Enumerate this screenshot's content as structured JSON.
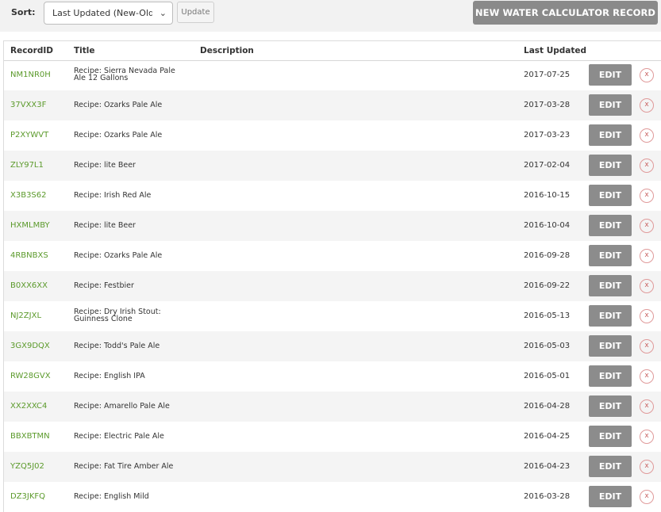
{
  "toolbar": {
    "sort_label": "Sort:",
    "sort_value": "Last Updated (New-Old)",
    "update_label": "Update",
    "new_record_label": "NEW WATER CALCULATOR RECORD"
  },
  "table": {
    "headers": {
      "record_id": "RecordID",
      "title": "Title",
      "description": "Description",
      "last_updated": "Last Updated"
    },
    "edit_label": "EDIT",
    "delete_label": "x",
    "rows": [
      {
        "id": "NM1NR0H",
        "title": "Recipe: Sierra Nevada Pale Ale 12 Gallons",
        "description": "",
        "updated": "2017-07-25"
      },
      {
        "id": "37VXX3F",
        "title": "Recipe: Ozarks Pale Ale",
        "description": "",
        "updated": "2017-03-28"
      },
      {
        "id": "P2XYWVT",
        "title": "Recipe: Ozarks Pale Ale",
        "description": "",
        "updated": "2017-03-23"
      },
      {
        "id": "ZLY97L1",
        "title": "Recipe: lite Beer",
        "description": "",
        "updated": "2017-02-04"
      },
      {
        "id": "X3B3S62",
        "title": "Recipe: Irish Red Ale",
        "description": "",
        "updated": "2016-10-15"
      },
      {
        "id": "HXMLMBY",
        "title": "Recipe: lite Beer",
        "description": "",
        "updated": "2016-10-04"
      },
      {
        "id": "4RBNBXS",
        "title": "Recipe: Ozarks Pale Ale",
        "description": "",
        "updated": "2016-09-28"
      },
      {
        "id": "B0XX6XX",
        "title": "Recipe: Festbier",
        "description": "",
        "updated": "2016-09-22"
      },
      {
        "id": "NJ2ZJXL",
        "title": "Recipe: Dry Irish Stout: Guinness Clone",
        "description": "",
        "updated": "2016-05-13"
      },
      {
        "id": "3GX9DQX",
        "title": "Recipe: Todd's Pale Ale",
        "description": "",
        "updated": "2016-05-03"
      },
      {
        "id": "RW28GVX",
        "title": "Recipe: English IPA",
        "description": "",
        "updated": "2016-05-01"
      },
      {
        "id": "XX2XXC4",
        "title": "Recipe: Amarello Pale Ale",
        "description": "",
        "updated": "2016-04-28"
      },
      {
        "id": "BBXBTMN",
        "title": "Recipe: Electric Pale Ale",
        "description": "",
        "updated": "2016-04-25"
      },
      {
        "id": "YZQ5J02",
        "title": "Recipe: Fat Tire Amber Ale",
        "description": "",
        "updated": "2016-04-23"
      },
      {
        "id": "DZ3JKFQ",
        "title": "Recipe: English Mild",
        "description": "",
        "updated": "2016-03-28"
      }
    ]
  }
}
